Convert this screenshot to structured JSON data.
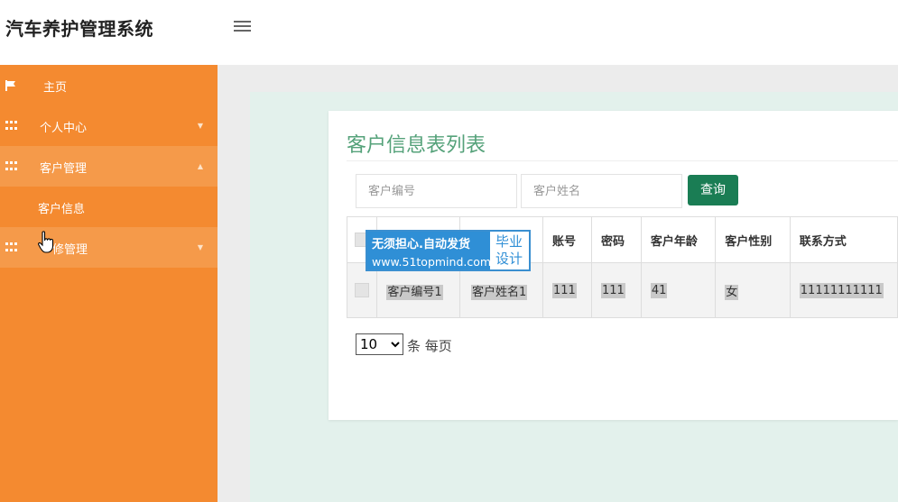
{
  "app": {
    "title": "汽车养护管理系统"
  },
  "sidebar": {
    "items": [
      {
        "label": "主页",
        "icon": "flag-icon"
      },
      {
        "label": "个人中心",
        "icon": "grid-icon"
      },
      {
        "label": "客户管理",
        "icon": "grid-icon",
        "expanded": true,
        "children": [
          {
            "label": "客户信息"
          }
        ]
      },
      {
        "label": "维修管理",
        "icon": "grid-icon",
        "visible_label": "修管理"
      }
    ]
  },
  "main": {
    "title": "客户信息表列表",
    "search": {
      "customer_no_placeholder": "客户编号",
      "customer_name_placeholder": "客户姓名",
      "button_label": "查询"
    },
    "table": {
      "headers": [
        "",
        "",
        "",
        "账号",
        "密码",
        "客户年龄",
        "客户性别",
        "联系方式"
      ],
      "rows": [
        [
          "",
          "客户编号1",
          "客户姓名1",
          "111",
          "111",
          "41",
          "女",
          "11111111111"
        ]
      ]
    },
    "pager": {
      "page_size": "10",
      "label": "条 每页",
      "options": [
        "10"
      ]
    }
  },
  "watermark": {
    "line1": "无须担心.自动发货",
    "url": "www.51topmind.com",
    "side_line1": "毕业",
    "side_line2": "设计"
  },
  "colors": {
    "sidebar": "#f48a30",
    "accent": "#1a7d54",
    "title": "#55a27a"
  }
}
